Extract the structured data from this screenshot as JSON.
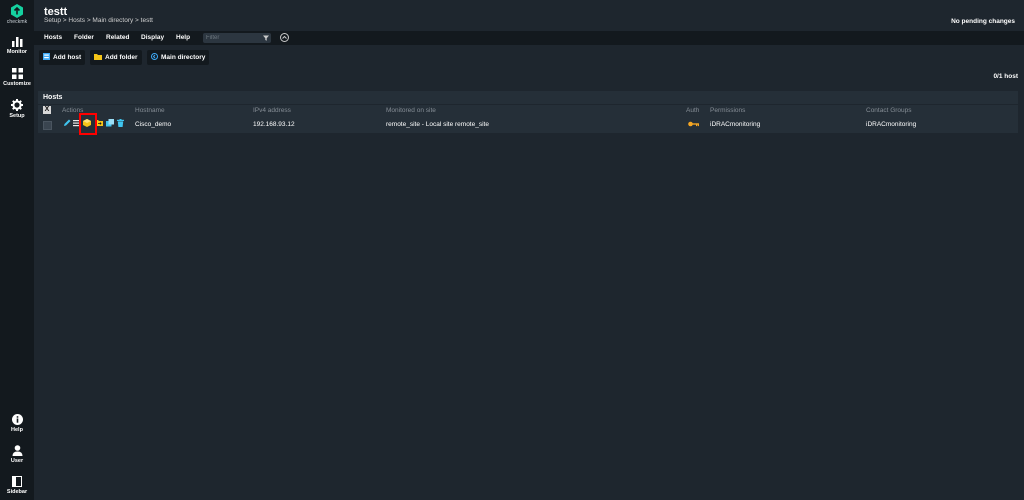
{
  "app": {
    "brand": "checkmk",
    "title": "testt",
    "breadcrumb": "Setup > Hosts > Main directory > testt",
    "pending_changes": "No pending changes"
  },
  "nav": {
    "top": [
      {
        "label": "Monitor",
        "icon": "bar-chart-icon"
      },
      {
        "label": "Customize",
        "icon": "grid-icon"
      },
      {
        "label": "Setup",
        "icon": "gear-icon"
      }
    ],
    "bottom": [
      {
        "label": "Help",
        "icon": "info-icon"
      },
      {
        "label": "User",
        "icon": "user-icon"
      },
      {
        "label": "Sidebar",
        "icon": "sidebar-icon"
      }
    ]
  },
  "menu": {
    "items": [
      "Hosts",
      "Folder",
      "Related",
      "Display",
      "Help"
    ],
    "filter_placeholder": "Filter"
  },
  "actions": {
    "add_host": "Add host",
    "add_folder": "Add folder",
    "main_directory": "Main directory"
  },
  "host_count": "0/1 host",
  "table": {
    "title": "Hosts",
    "select_all": "X",
    "columns": [
      "Actions",
      "Hostname",
      "IPv4 address",
      "Monitored on site",
      "Auth",
      "Permissions",
      "Contact Groups"
    ],
    "rows": [
      {
        "hostname": "Cisco_demo",
        "ipv4": "192.168.93.12",
        "site": "remote_site - Local site remote_site",
        "auth_icon": "key-icon",
        "permissions": "iDRACmonitoring",
        "contact_groups": "iDRACmonitoring"
      }
    ]
  },
  "colors": {
    "background": "#1e262e",
    "nav": "#13191e",
    "accent": "#15d1a0",
    "highlight": "#ff0000"
  }
}
